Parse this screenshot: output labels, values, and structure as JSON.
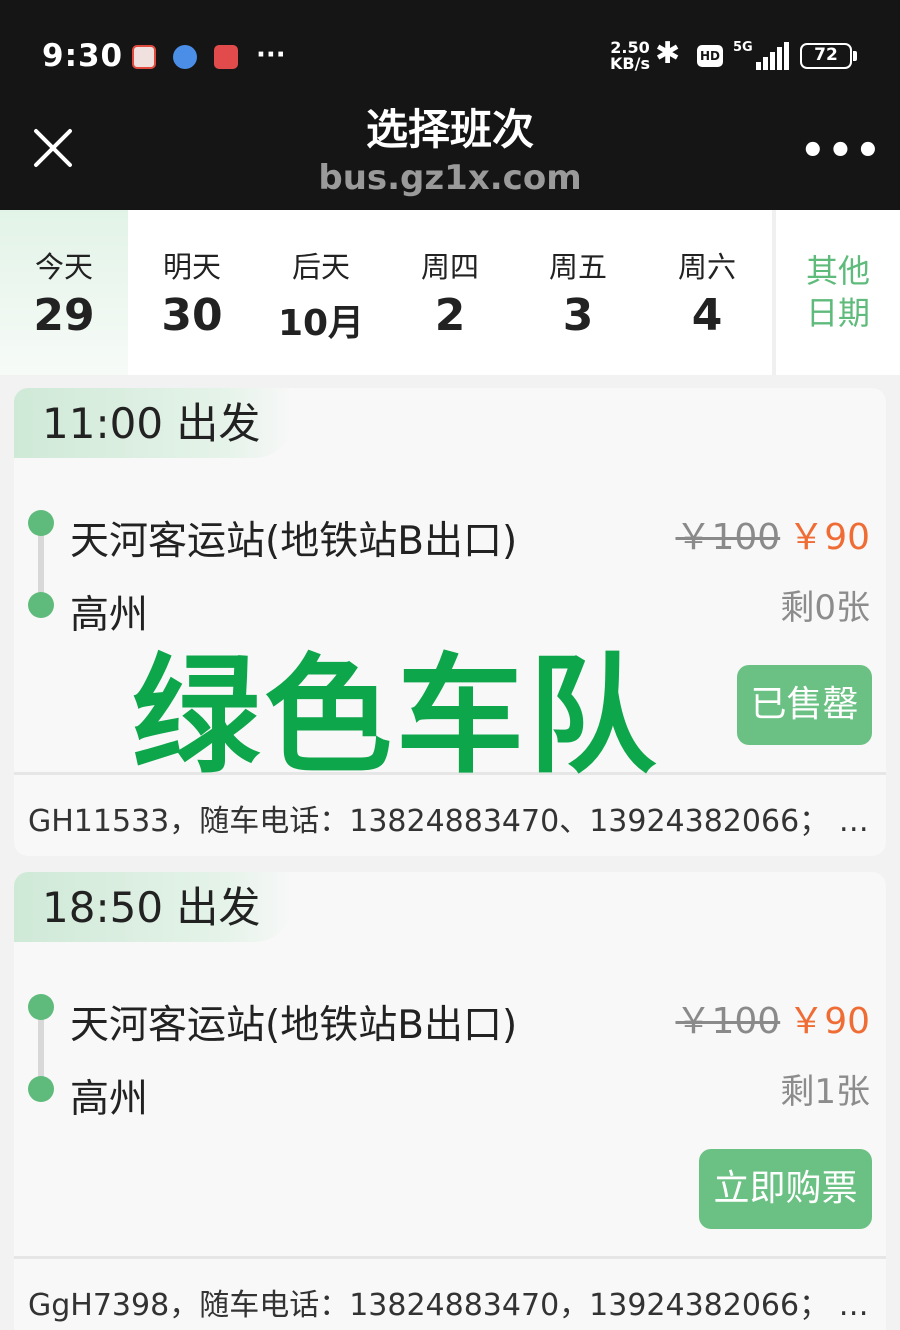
{
  "status_bar": {
    "time": "9:30",
    "net_speed_value": "2.50",
    "net_speed_unit": "KB/s",
    "hd": "HD",
    "signal": "5G",
    "battery": "72"
  },
  "header": {
    "title": "选择班次",
    "subtitle": "bus.gz1x.com",
    "close_icon": "close-icon",
    "more_icon": "more-icon"
  },
  "dates": [
    {
      "label": "今天",
      "num": "29"
    },
    {
      "label": "明天",
      "num": "30"
    },
    {
      "label": "后天",
      "num": "10月"
    },
    {
      "label": "周四",
      "num": "2"
    },
    {
      "label": "周五",
      "num": "3"
    },
    {
      "label": "周六",
      "num": "4"
    }
  ],
  "other_date": {
    "line1": "其他",
    "line2": "日期"
  },
  "trips": [
    {
      "depart": "11:00 出发",
      "from": "天河客运站(地铁站B出口)",
      "to": "高州",
      "old_price": "￥100",
      "price": "￥90",
      "remaining": "剩0张",
      "button": "已售罄",
      "note": "GH11533，随车电话：13824883470、13924382066；  …"
    },
    {
      "depart": "18:50 出发",
      "from": "天河客运站(地铁站B出口)",
      "to": "高州",
      "old_price": "￥100",
      "price": "￥90",
      "remaining": "剩1张",
      "button": "立即购票",
      "note": "GgH7398，随车电话：13824883470，13924382066；  …"
    }
  ],
  "watermark": "绿色车队",
  "colors": {
    "accent": "#6bc183",
    "price": "#ef6c35",
    "header_bg": "#151515",
    "watermark": "#0ea64b"
  }
}
